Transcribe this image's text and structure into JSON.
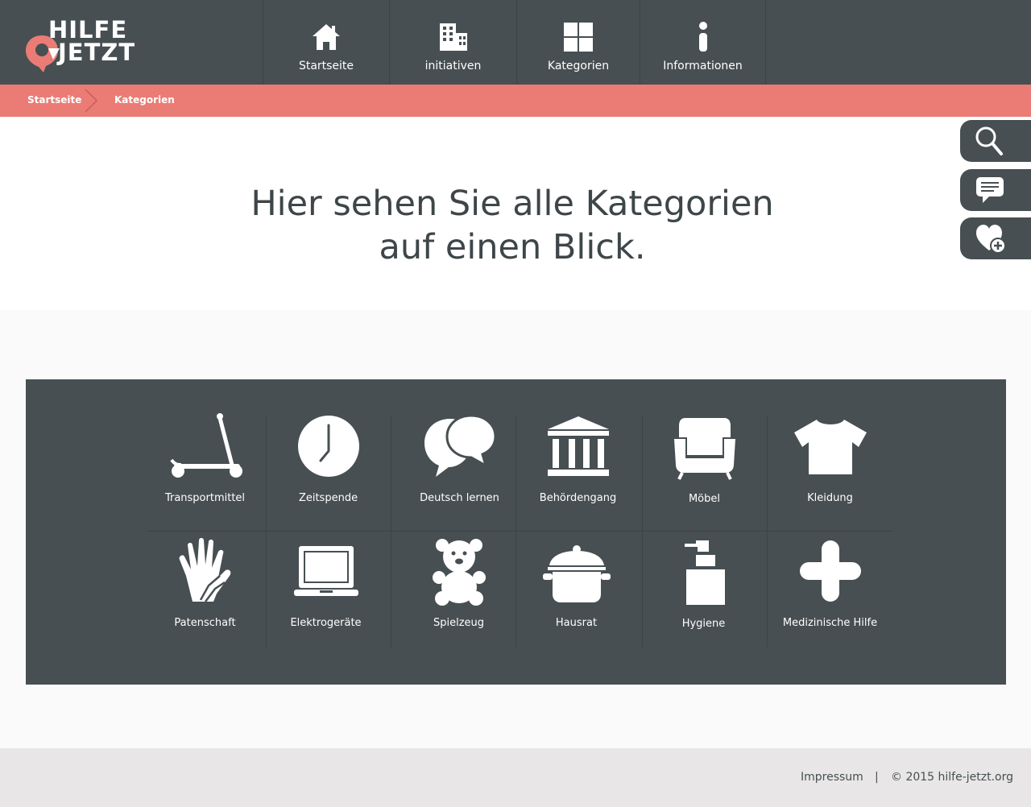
{
  "brand": {
    "line1": "HILFE",
    "line2": "JETZT",
    "accent": "#ea7c75",
    "dark": "#474f52"
  },
  "nav": {
    "items": [
      {
        "label": "Startseite",
        "icon": "home-icon"
      },
      {
        "label": "initiativen",
        "icon": "building-icon"
      },
      {
        "label": "Kategorien",
        "icon": "grid-icon"
      },
      {
        "label": "Informationen",
        "icon": "info-icon"
      }
    ]
  },
  "breadcrumb": {
    "items": [
      "Startseite",
      "Kategorien"
    ]
  },
  "side_tabs": [
    "search-icon",
    "chat-icon",
    "heart-add-icon"
  ],
  "headline": {
    "line1": "Hier sehen Sie alle Kategorien",
    "line2": "auf einen Blick."
  },
  "categories": [
    {
      "label": "Transportmittel",
      "icon": "scooter-icon"
    },
    {
      "label": "Zeitspende",
      "icon": "clock-icon"
    },
    {
      "label": "Deutsch lernen",
      "icon": "speech-bubbles-icon"
    },
    {
      "label": "Behördengang",
      "icon": "government-building-icon"
    },
    {
      "label": "Möbel",
      "icon": "armchair-icon"
    },
    {
      "label": "Kleidung",
      "icon": "tshirt-icon"
    },
    {
      "label": "Patenschaft",
      "icon": "hands-icon"
    },
    {
      "label": "Elektrogeräte",
      "icon": "laptop-icon"
    },
    {
      "label": "Spielzeug",
      "icon": "teddy-bear-icon"
    },
    {
      "label": "Hausrat",
      "icon": "cooking-pot-icon"
    },
    {
      "label": "Hygiene",
      "icon": "soap-dispenser-icon"
    },
    {
      "label": "Medizinische Hilfe",
      "icon": "medical-cross-icon"
    }
  ],
  "footer": {
    "impressum": "Impressum",
    "separator": "|",
    "copyright": "© 2015 hilfe-jetzt.org"
  }
}
